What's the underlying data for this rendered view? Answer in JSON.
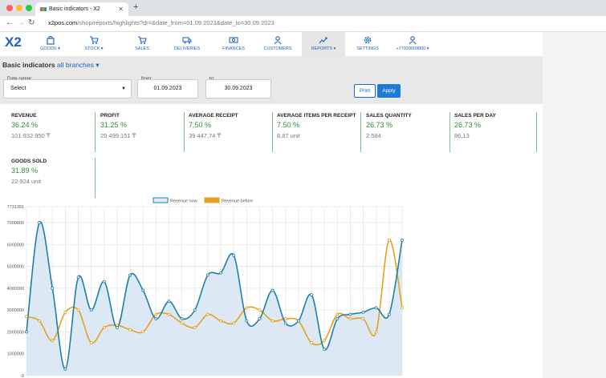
{
  "browser": {
    "tab_title": "Basic indicators - X2",
    "close_glyph": "✕",
    "newtab_glyph": "+",
    "url_host": "x2pos.com",
    "url_path": "/shop/reports/highlights?dr=&date_from=01.09.2023&date_to=30.09.2023"
  },
  "app": {
    "logo": "X2",
    "nav": [
      {
        "label": "GOODS ▾",
        "icon": "bag-icon"
      },
      {
        "label": "STOCK ▾",
        "icon": "cart-icon"
      },
      {
        "label": "SALES",
        "icon": "cart-icon"
      },
      {
        "label": "DELIVERIES",
        "icon": "truck-icon"
      },
      {
        "label": "FINANCES",
        "icon": "cash-icon"
      },
      {
        "label": "CUSTOMERS",
        "icon": "users-icon"
      },
      {
        "label": "REPORTS ▾",
        "icon": "chart-icon"
      },
      {
        "label": "SETTINGS",
        "icon": "gear-icon"
      },
      {
        "label": "+77020009800 ▾",
        "icon": "user-icon"
      }
    ],
    "active_nav": "REPORTS ▾",
    "accent": "#1e63c2"
  },
  "filters": {
    "title": "Basic indicators",
    "branches": "all branches ▾",
    "date_range_label": "Date range:",
    "date_range_value": "Select",
    "from_label": "from:",
    "from_value": "01.09.2023",
    "to_label": "to:",
    "to_value": "30.09.2023",
    "print": "Print",
    "apply": "Apply"
  },
  "metrics": [
    {
      "title": "REVENUE",
      "pct": "36.24 %",
      "value": "101 932 950 ₸"
    },
    {
      "title": "PROFIT",
      "pct": "31.25 %",
      "value": "29 499 151 ₸"
    },
    {
      "title": "AVERAGE RECEIPT",
      "pct": "7.50 %",
      "value": "39 447,74 ₸"
    },
    {
      "title": "AVERAGE ITEMS PER RECEIPT",
      "pct": "7.50 %",
      "value": "8,87 unit"
    },
    {
      "title": "SALES QUANTITY",
      "pct": "26.73 %",
      "value": "2 584"
    },
    {
      "title": "SALES PER DAY",
      "pct": "26.73 %",
      "value": "86,13"
    },
    {
      "title": "GOODS SOLD",
      "pct": "31.89 %",
      "value": "22 924 unit"
    }
  ],
  "chart_data": {
    "type": "line",
    "title": "",
    "xlabel": "",
    "ylabel": "",
    "ylim": [
      0,
      7731391
    ],
    "yticks": [
      "7731391",
      "7000000",
      "6000000",
      "5000000",
      "4000000",
      "3000000",
      "2000000",
      "1000000",
      "0"
    ],
    "legend_position": "top",
    "grid": true,
    "x": [
      1,
      2,
      3,
      4,
      5,
      6,
      7,
      8,
      9,
      10,
      11,
      12,
      13,
      14,
      15,
      16,
      17,
      18,
      19,
      20,
      21,
      22,
      23,
      24,
      25,
      26,
      27,
      28,
      29,
      30
    ],
    "series": [
      {
        "name": "Revenue now",
        "color": "#1e7fa8",
        "fill": "#dce9f5",
        "values": [
          2000000,
          7000000,
          4000000,
          300000,
          4500000,
          3000000,
          4300000,
          2200000,
          4600000,
          3900000,
          2600000,
          3400000,
          2600000,
          3000000,
          4600000,
          4700000,
          5500000,
          2500000,
          2600000,
          3900000,
          2400000,
          2500000,
          3700000,
          1200000,
          2600000,
          2800000,
          2900000,
          3100000,
          2800000,
          6200000
        ]
      },
      {
        "name": "Revenue before",
        "color": "#e6a020",
        "values": [
          2700000,
          2500000,
          1600000,
          2900000,
          3000000,
          1500000,
          2200000,
          2300000,
          2100000,
          2000000,
          2800000,
          2800000,
          2400000,
          2200000,
          2800000,
          2500000,
          2400000,
          3100000,
          3000000,
          2500000,
          2600000,
          2500000,
          1500000,
          1600000,
          2800000,
          2600000,
          2600000,
          2000000,
          6200000,
          3100000
        ]
      }
    ]
  }
}
